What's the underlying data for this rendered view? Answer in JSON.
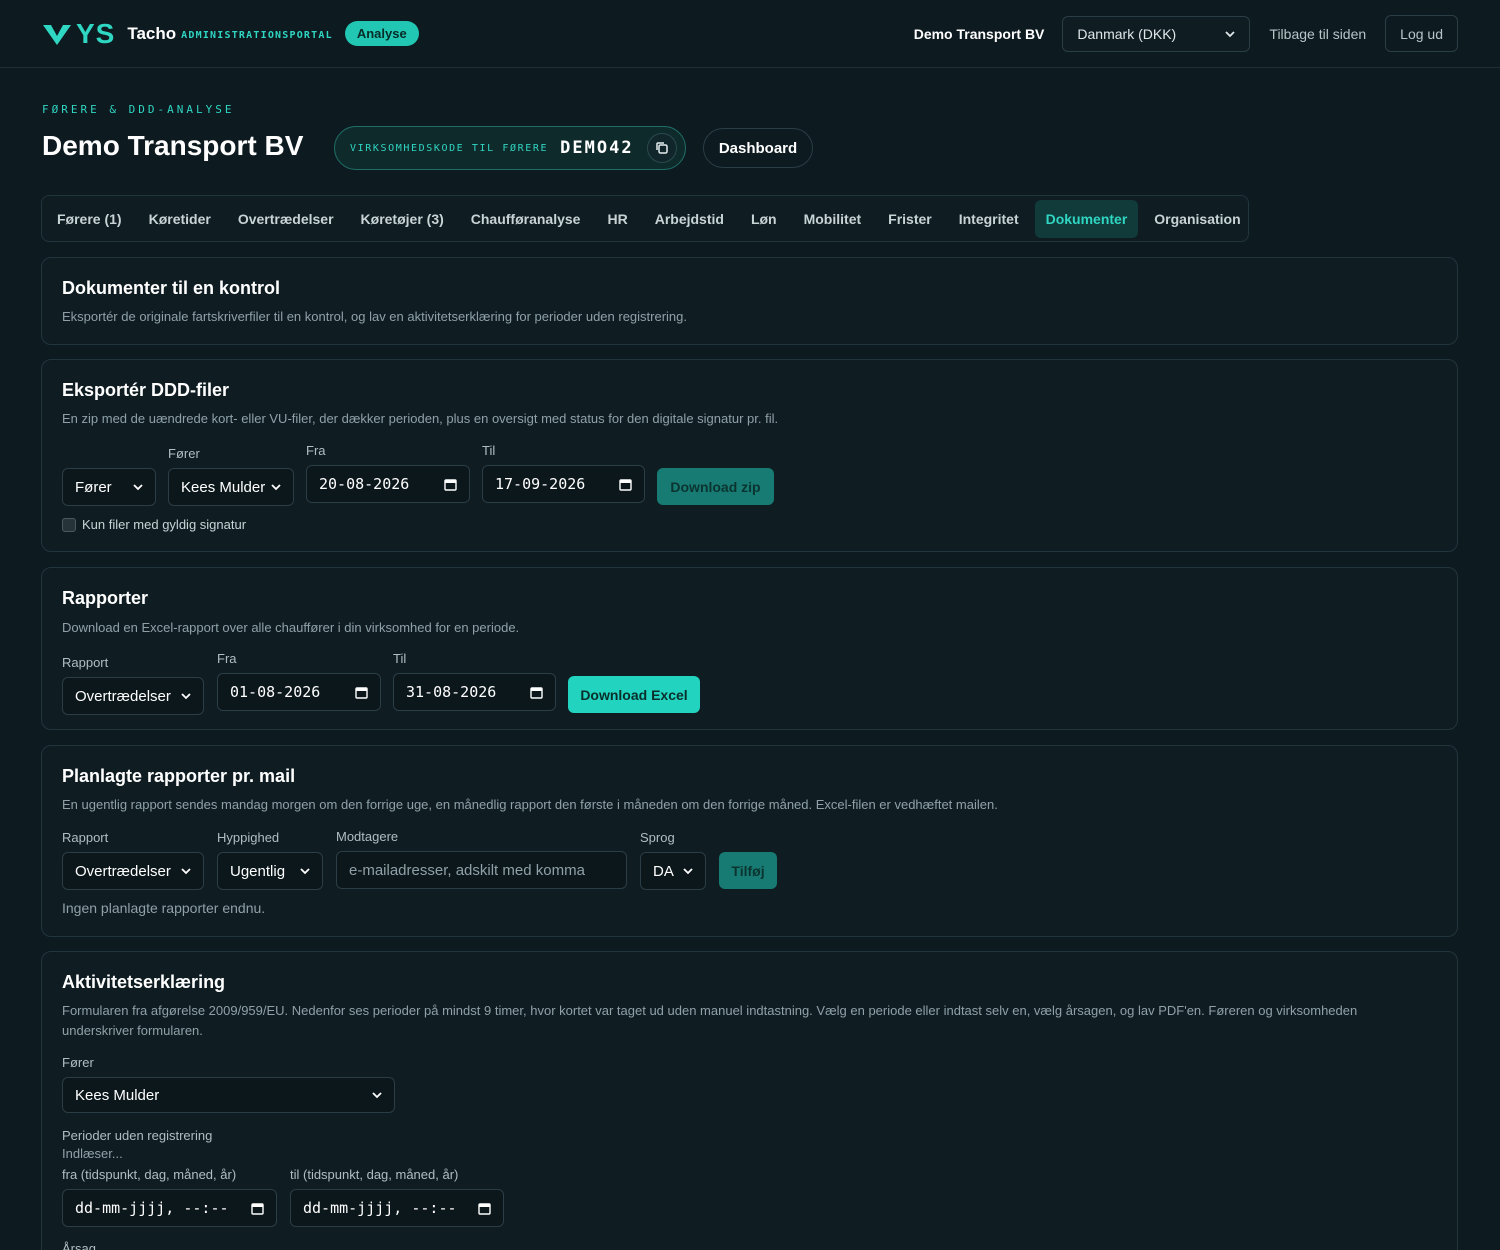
{
  "header": {
    "logo_text": "YS",
    "brand": "Tacho",
    "brand_sub": "ADMINISTRATIONSPORTAL",
    "badge": "Analyse",
    "company": "Demo Transport BV",
    "country_select": "Danmark (DKK)",
    "back_link": "Tilbage til siden",
    "logout": "Log ud"
  },
  "page": {
    "eyebrow": "FØRERE & DDD-ANALYSE",
    "title": "Demo Transport BV",
    "code_label": "VIRKSOMHEDSKODE TIL FØRERE",
    "code_value": "DEMO42",
    "dashboard_button": "Dashboard"
  },
  "tabs": [
    {
      "label": "Førere (1)"
    },
    {
      "label": "Køretider"
    },
    {
      "label": "Overtrædelser"
    },
    {
      "label": "Køretøjer (3)"
    },
    {
      "label": "Chaufføranalyse"
    },
    {
      "label": "HR"
    },
    {
      "label": "Arbejdstid"
    },
    {
      "label": "Løn"
    },
    {
      "label": "Mobilitet"
    },
    {
      "label": "Frister"
    },
    {
      "label": "Integritet"
    },
    {
      "label": "Dokumenter",
      "active": true
    },
    {
      "label": "Organisation"
    }
  ],
  "control_card": {
    "title": "Dokumenter til en kontrol",
    "desc": "Eksportér de originale fartskriverfiler til en kontrol, og lav en aktivitetserklæring for perioder uden registrering."
  },
  "export_card": {
    "title": "Eksportér DDD-filer",
    "desc": "En zip med de uændrede kort- eller VU-filer, der dækker perioden, plus en oversigt med status for den digitale signatur pr. fil.",
    "type_value": "Fører",
    "driver_label": "Fører",
    "driver_value": "Kees Mulder",
    "from_label": "Fra",
    "from_value": "20-08-2026",
    "to_label": "Til",
    "to_value": "17-09-2026",
    "download_button": "Download zip",
    "checkbox_label": "Kun filer med gyldig signatur"
  },
  "reports_card": {
    "title": "Rapporter",
    "desc": "Download en Excel-rapport over alle chauffører i din virksomhed for en periode.",
    "report_label": "Rapport",
    "report_value": "Overtrædelser",
    "from_label": "Fra",
    "from_value": "01-08-2026",
    "to_label": "Til",
    "to_value": "31-08-2026",
    "download_button": "Download Excel"
  },
  "scheduled_card": {
    "title": "Planlagte rapporter pr. mail",
    "desc": "En ugentlig rapport sendes mandag morgen om den forrige uge, en månedlig rapport den første i måneden om den forrige måned. Excel-filen er vedhæftet mailen.",
    "report_label": "Rapport",
    "report_value": "Overtrædelser",
    "frequency_label": "Hyppighed",
    "frequency_value": "Ugentlig",
    "recipients_label": "Modtagere",
    "recipients_placeholder": "e-mailadresser, adskilt med komma",
    "language_label": "Sprog",
    "language_value": "DA",
    "add_button": "Tilføj",
    "empty_text": "Ingen planlagte rapporter endnu."
  },
  "activity_card": {
    "title": "Aktivitetserklæring",
    "desc_line1": "Formularen fra afgørelse 2009/959/EU. Nedenfor ses perioder på mindst 9 timer, hvor kortet var taget ud uden manuel indtastning. Vælg en periode eller indtast selv en, vælg årsagen, og lav PDF'en. Føreren og virksomheden",
    "desc_line2": "underskriver formularen.",
    "driver_label": "Fører",
    "driver_value": "Kees Mulder",
    "periods_label": "Perioder uden registrering",
    "loading": "Indlæser...",
    "from_label": "fra (tidspunkt, dag, måned, år)",
    "from_placeholder": "dd-mm-jjjj, --:--",
    "to_label": "til (tidspunkt, dag, måned, år)",
    "to_placeholder": "dd-mm-jjjj, --:--",
    "reason_label": "Årsag"
  },
  "colors": {
    "accent": "#22d3bf",
    "background": "#0d1a20",
    "card": "#0f1d23"
  }
}
